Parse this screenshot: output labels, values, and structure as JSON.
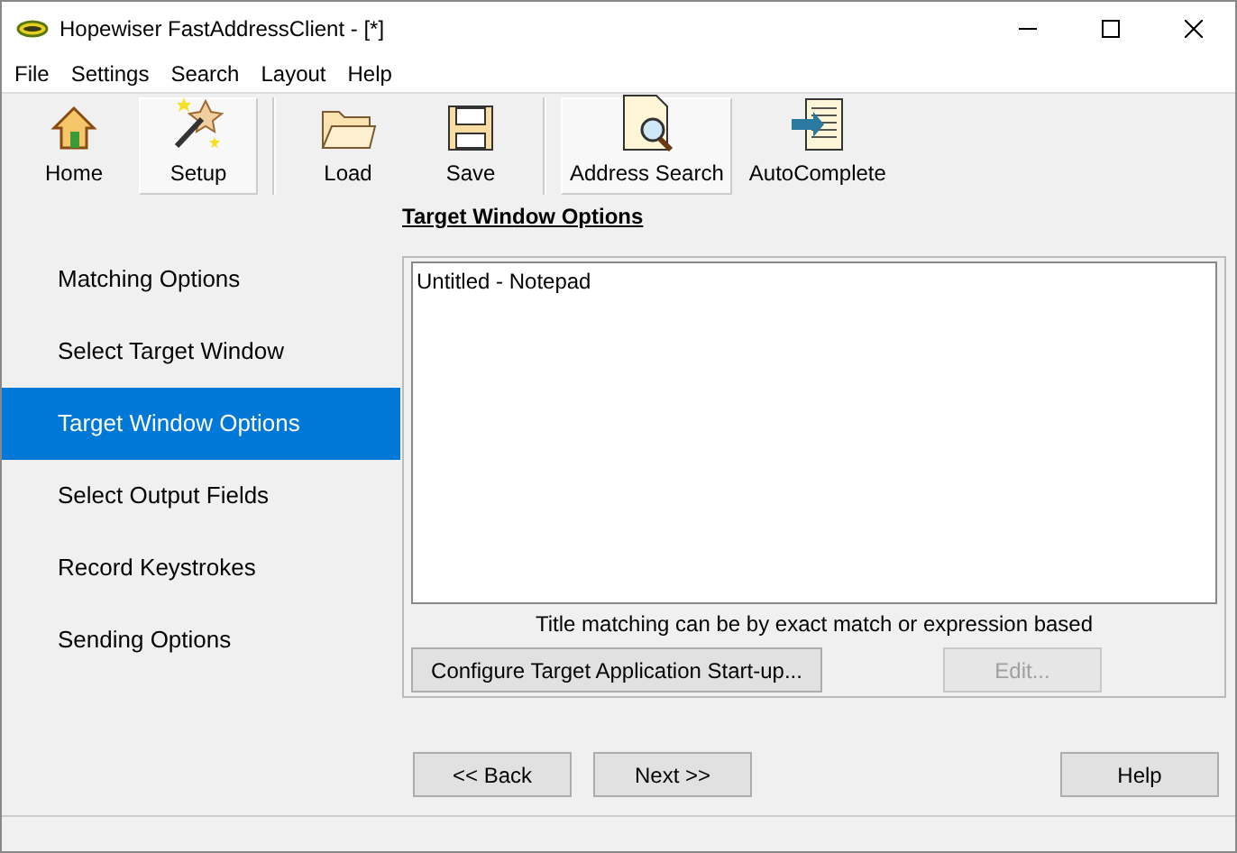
{
  "window": {
    "title": "Hopewiser FastAddressClient - [*]"
  },
  "menu": [
    "File",
    "Settings",
    "Search",
    "Layout",
    "Help"
  ],
  "toolbar": [
    {
      "label": "Home",
      "selected": false
    },
    {
      "label": "Setup",
      "selected": true
    },
    {
      "label": "Load",
      "selected": false,
      "sep_before": true
    },
    {
      "label": "Save",
      "selected": false
    },
    {
      "label": "Address Search",
      "selected": true,
      "sep_before": true
    },
    {
      "label": "AutoComplete",
      "selected": false
    }
  ],
  "heading": "Target Window Options",
  "sidebar": {
    "items": [
      {
        "label": "Matching Options",
        "selected": false
      },
      {
        "label": "Select Target Window",
        "selected": false
      },
      {
        "label": "Target Window Options",
        "selected": true
      },
      {
        "label": "Select Output Fields",
        "selected": false
      },
      {
        "label": "Record Keystrokes",
        "selected": false
      },
      {
        "label": "Sending Options",
        "selected": false
      }
    ]
  },
  "window_list": {
    "items": [
      "Untitled - Notepad"
    ]
  },
  "hint": "Title matching can be by exact match or expression based",
  "panel_buttons": [
    {
      "label": "Configure Target Application Start-up...",
      "disabled": false
    },
    {
      "label": "Edit...",
      "disabled": true
    }
  ],
  "footer_buttons": [
    {
      "label": "<< Back"
    },
    {
      "label": "Next >>"
    },
    {
      "label": "Help"
    }
  ]
}
